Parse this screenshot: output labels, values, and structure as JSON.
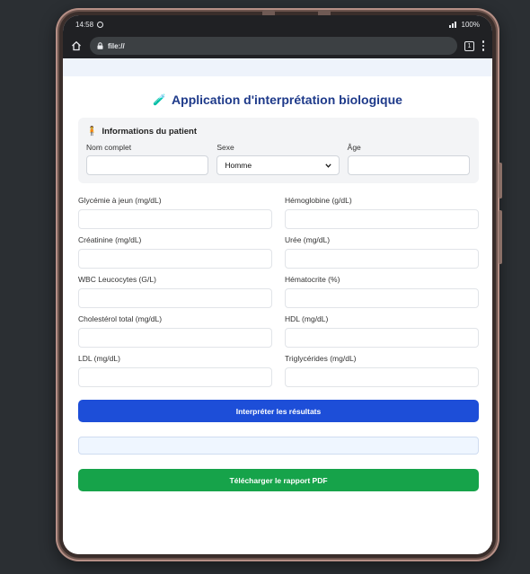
{
  "statusbar": {
    "time": "14:58",
    "battery": "100%"
  },
  "browser": {
    "url": "file://",
    "tab_count": "1"
  },
  "app": {
    "title_icon": "🧪",
    "title": "Application d'interprétation biologique"
  },
  "patient": {
    "icon": "🧍",
    "section_title": "Informations du patient",
    "name_label": "Nom complet",
    "name_value": "",
    "sex_label": "Sexe",
    "sex_value": "Homme",
    "age_label": "Âge",
    "age_value": ""
  },
  "fields": {
    "glycemie": "Glycémie à jeun (mg/dL)",
    "hemoglobine": "Hémoglobine (g/dL)",
    "creatinine": "Créatinine (mg/dL)",
    "uree": "Urée (mg/dL)",
    "wbc": "WBC Leucocytes (G/L)",
    "hematocrite": "Hématocrite (%)",
    "cholesterol": "Cholestérol total (mg/dL)",
    "hdl": "HDL (mg/dL)",
    "ldl": "LDL (mg/dL)",
    "triglycerides": "Triglycérides (mg/dL)"
  },
  "buttons": {
    "interpret": "Interpréter les résultats",
    "pdf": "Télécharger le rapport PDF"
  },
  "colors": {
    "primary": "#1d4ed8",
    "success": "#16a34a",
    "title": "#1e3a8a"
  }
}
